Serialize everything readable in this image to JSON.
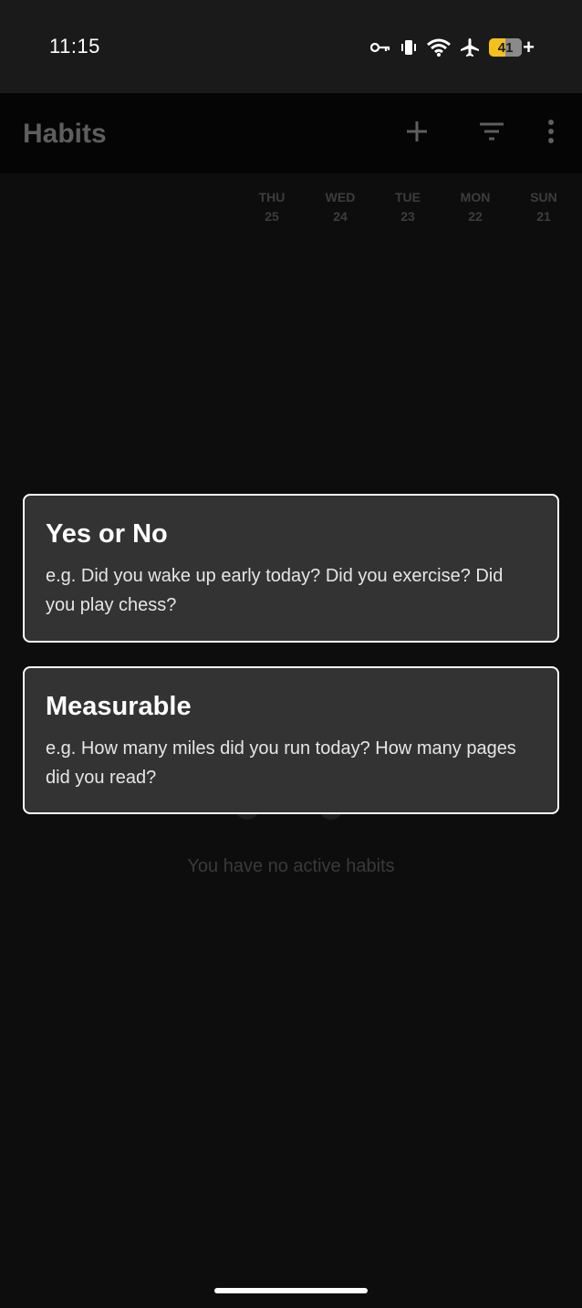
{
  "status_bar": {
    "time": "11:15",
    "battery_level": "41",
    "battery_charging": "+",
    "icons": [
      "vpn-key-icon",
      "vibrate-icon",
      "wifi-icon",
      "airplane-icon",
      "battery-icon"
    ]
  },
  "app_bar": {
    "title": "Habits",
    "actions": [
      "add-icon",
      "filter-icon",
      "more-vert-icon"
    ]
  },
  "days": [
    {
      "name": "THU",
      "num": "25"
    },
    {
      "name": "WED",
      "num": "24"
    },
    {
      "name": "TUE",
      "num": "23"
    },
    {
      "name": "MON",
      "num": "22"
    },
    {
      "name": "SUN",
      "num": "21"
    }
  ],
  "empty_state": {
    "message": "You have no active habits"
  },
  "dialog": {
    "options": [
      {
        "title": "Yes or No",
        "description": "e.g. Did you wake up early today? Did you exercise? Did you play chess?"
      },
      {
        "title": "Measurable",
        "description": "e.g. How many miles did you run today? How many pages did you read?"
      }
    ]
  },
  "colors": {
    "background": "#0d0d0d",
    "status_bar": "#1a1a1a",
    "app_bar": "#050505",
    "card": "#333333",
    "card_border": "#ffffff",
    "battery": "#f2c21b"
  }
}
